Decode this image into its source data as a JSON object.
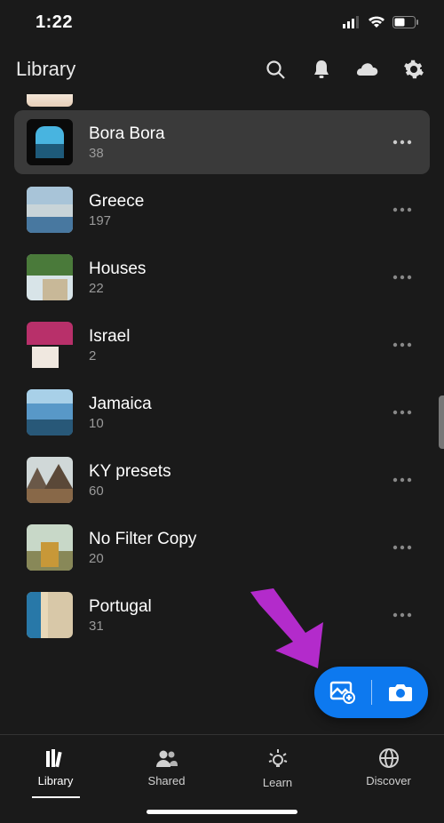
{
  "status": {
    "time": "1:22"
  },
  "header": {
    "title": "Library"
  },
  "albums": [
    {
      "title": "Bora Bora",
      "count": "38",
      "selected": true
    },
    {
      "title": "Greece",
      "count": "197",
      "selected": false
    },
    {
      "title": "Houses",
      "count": "22",
      "selected": false
    },
    {
      "title": "Israel",
      "count": "2",
      "selected": false
    },
    {
      "title": "Jamaica",
      "count": "10",
      "selected": false
    },
    {
      "title": "KY presets",
      "count": "60",
      "selected": false
    },
    {
      "title": "No Filter Copy",
      "count": "20",
      "selected": false
    },
    {
      "title": "Portugal",
      "count": "31",
      "selected": false
    }
  ],
  "nav": {
    "items": [
      {
        "label": "Library",
        "active": true
      },
      {
        "label": "Shared",
        "active": false
      },
      {
        "label": "Learn",
        "active": false
      },
      {
        "label": "Discover",
        "active": false
      }
    ]
  },
  "colors": {
    "accent": "#0d79ef",
    "annotation": "#b32bcb"
  }
}
